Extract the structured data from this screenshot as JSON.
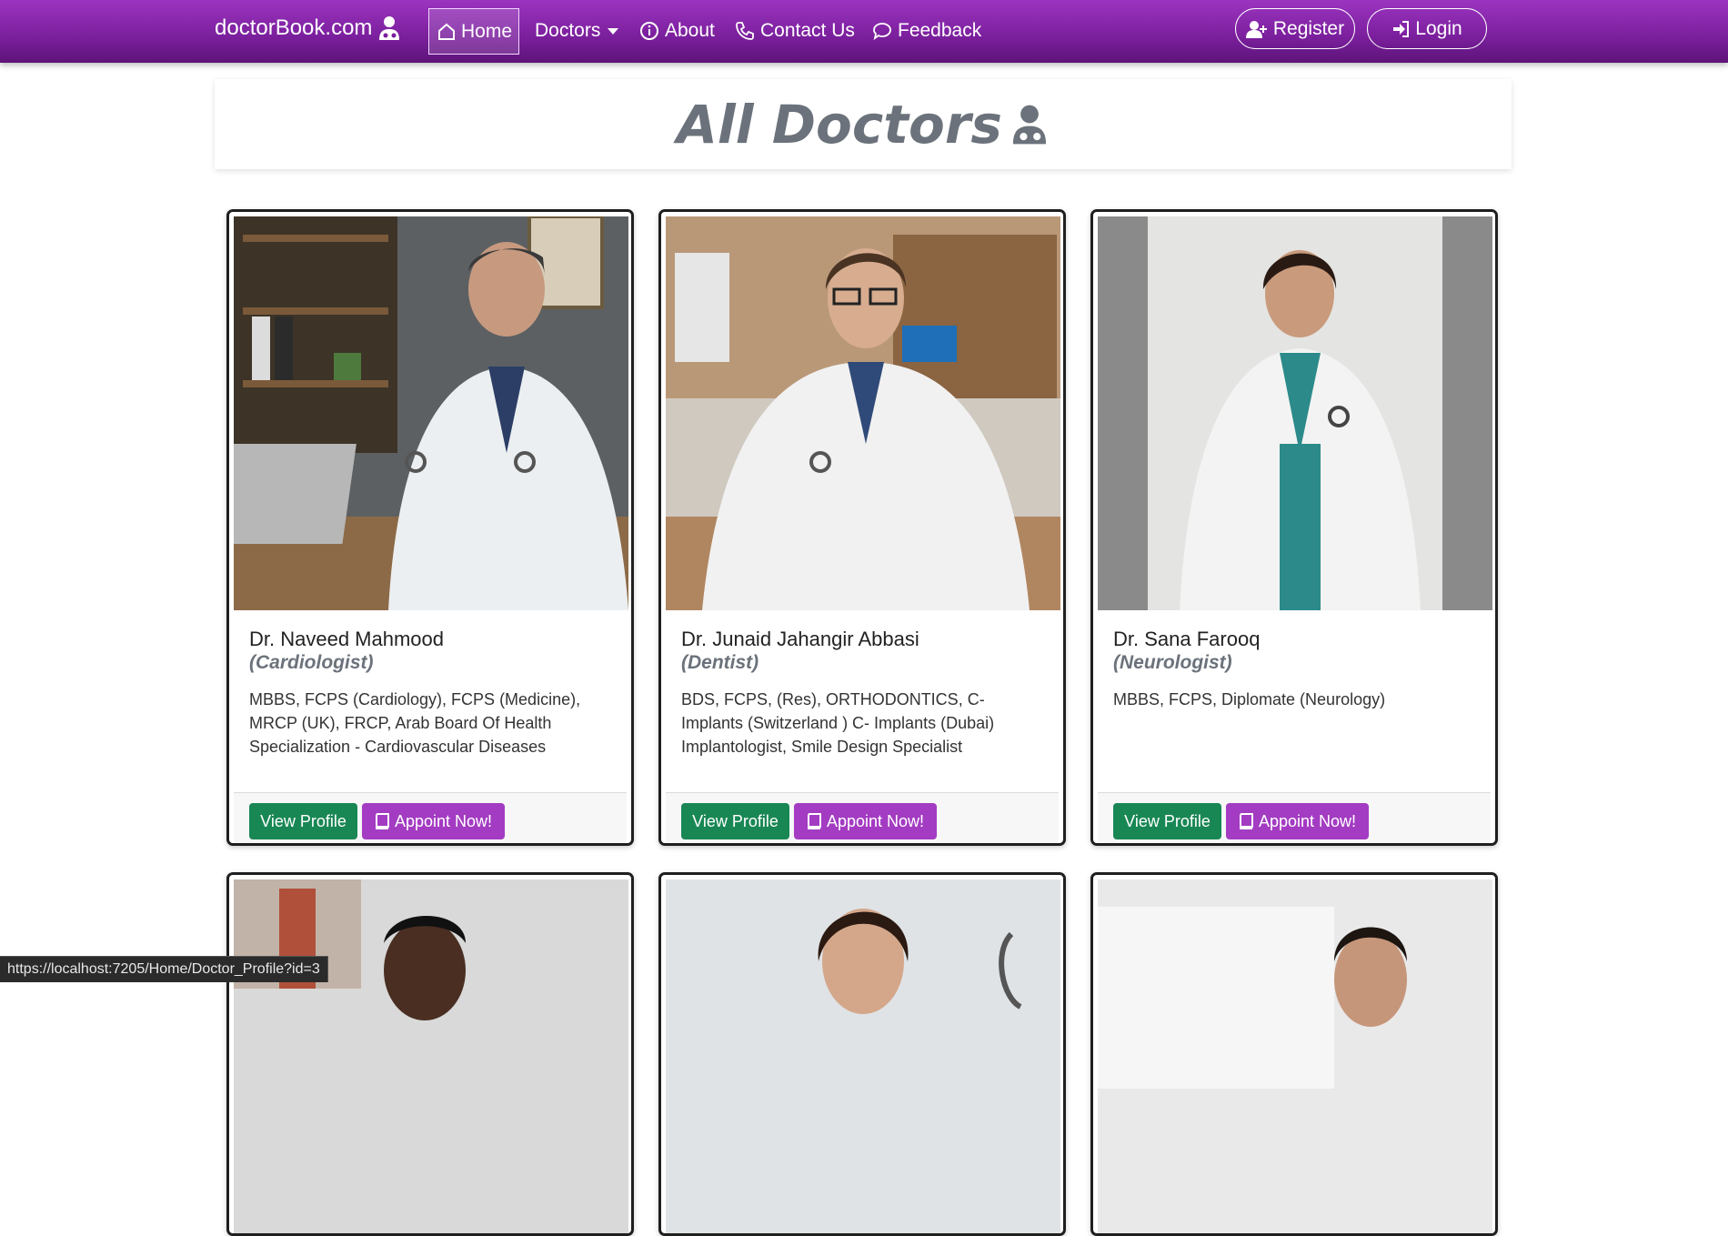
{
  "navbar": {
    "brand": "doctorBook.com",
    "items": [
      {
        "label": "Home",
        "icon": "house-icon"
      },
      {
        "label": "Doctors",
        "icon": "caret-down-icon"
      },
      {
        "label": "About",
        "icon": "info-circle-icon"
      },
      {
        "label": "Contact Us",
        "icon": "phone-icon"
      },
      {
        "label": "Feedback",
        "icon": "chat-icon"
      }
    ],
    "register": "Register",
    "login": "Login"
  },
  "page": {
    "title": "All Doctors"
  },
  "doctors": [
    {
      "name": "Dr. Naveed Mahmood",
      "specialty": "(Cardiologist)",
      "qualifications": "MBBS, FCPS (Cardiology), FCPS (Medicine), MRCP (UK), FRCP, Arab Board Of Health Specialization - Cardiovascular Diseases",
      "view_label": "View Profile",
      "appoint_label": "Appoint Now!"
    },
    {
      "name": "Dr. Junaid Jahangir Abbasi",
      "specialty": "(Dentist)",
      "qualifications": "BDS, FCPS, (Res), ORTHODONTICS, C-Implants (Switzerland ) C- Implants (Dubai) Implantologist, Smile Design Specialist",
      "view_label": "View Profile",
      "appoint_label": "Appoint Now!"
    },
    {
      "name": "Dr. Sana Farooq",
      "specialty": "(Neurologist)",
      "qualifications": "MBBS, FCPS, Diplomate (Neurology)",
      "view_label": "View Profile",
      "appoint_label": "Appoint Now!"
    }
  ],
  "status_url": "https://localhost:7205/Home/Doctor_Profile?id=3",
  "colors": {
    "navbar": "#7a1f9c",
    "primary_purple": "#a33cc2",
    "success_green": "#198754",
    "title_gray": "#6b727b"
  }
}
